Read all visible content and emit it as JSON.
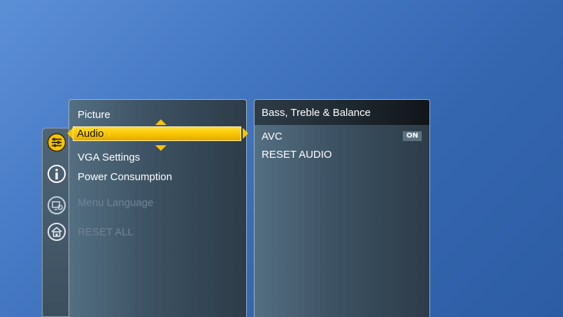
{
  "main_menu": {
    "items": [
      {
        "label": "Picture",
        "enabled": true
      },
      {
        "label": "Audio",
        "enabled": true,
        "selected": true
      },
      {
        "label": "VGA Settings",
        "enabled": true
      },
      {
        "label": "Power Consumption",
        "enabled": true
      },
      {
        "label": "Menu Language",
        "enabled": false
      },
      {
        "label": "RESET ALL",
        "enabled": false
      }
    ]
  },
  "submenu": {
    "title": "Bass, Treble & Balance",
    "items": [
      {
        "label": "AVC",
        "value": "ON"
      },
      {
        "label": "RESET AUDIO"
      }
    ]
  },
  "icon_rail": {
    "icons": [
      "settings-sliders-icon",
      "info-icon",
      "display-settings-icon",
      "home-icon"
    ]
  },
  "colors": {
    "selection": "#f8c400",
    "background": "#3466b0",
    "panel": "#3d5263",
    "disabled_text": "#6f8494"
  }
}
